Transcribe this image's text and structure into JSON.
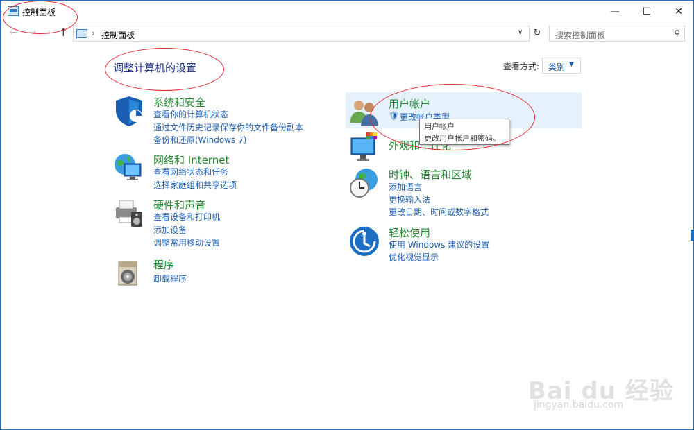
{
  "window": {
    "title": "控制面板",
    "min_glyph": "—",
    "max_glyph": "☐",
    "close_glyph": "✕"
  },
  "nav": {
    "back": "←",
    "forward": "→",
    "down": "∨",
    "up": "↑",
    "breadcrumb_sep": "›",
    "address": "控制面板",
    "dropdown_glyph": "∨",
    "refresh_glyph": "↻",
    "search_placeholder": "搜索控制面板",
    "search_glyph": "⚲"
  },
  "main": {
    "heading": "调整计算机的设置",
    "view_by_label": "查看方式:",
    "view_by_value": "类别",
    "view_by_caret": "▼"
  },
  "categories_left": [
    {
      "title": "系统和安全",
      "links": [
        "查看你的计算机状态",
        "通过文件历史记录保存你的文件备份副本",
        "备份和还原(Windows 7)"
      ]
    },
    {
      "title": "网络和 Internet",
      "links": [
        "查看网络状态和任务",
        "选择家庭组和共享选项"
      ]
    },
    {
      "title": "硬件和声音",
      "links": [
        "查看设备和打印机",
        "添加设备",
        "调整常用移动设置"
      ]
    },
    {
      "title": "程序",
      "links": [
        "卸载程序"
      ]
    }
  ],
  "categories_right": [
    {
      "title": "用户帐户",
      "links": [
        "更改帐户类型"
      ]
    },
    {
      "title": "外观和个性化",
      "links": []
    },
    {
      "title": "时钟、语言和区域",
      "links": [
        "添加语言",
        "更换输入法",
        "更改日期、时间或数字格式"
      ]
    },
    {
      "title": "轻松使用",
      "links": [
        "使用 Windows 建议的设置",
        "优化视觉显示"
      ]
    }
  ],
  "tooltip": {
    "line1": "用户帐户",
    "line2": "更改用户帐户和密码。"
  },
  "watermark": {
    "text": "Bai du 经验",
    "url": "jingyan.baidu.com"
  },
  "colors": {
    "category_title": "#1f8a2d",
    "link": "#1e5fb4",
    "heading": "#1e3287",
    "annotation": "#e0282e",
    "hover_bg": "#e5f1fb"
  }
}
